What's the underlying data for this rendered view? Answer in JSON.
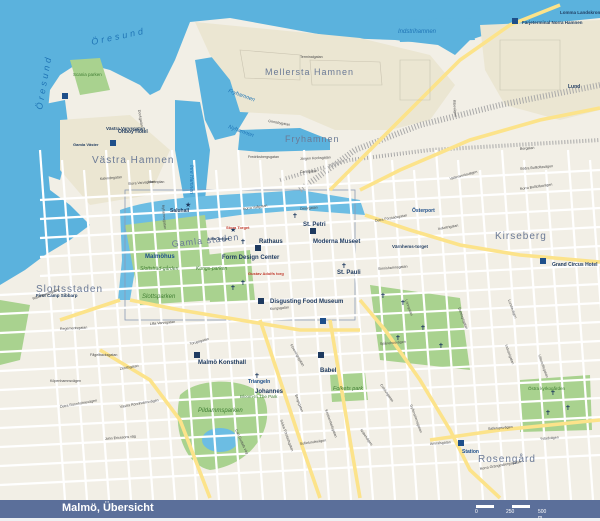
{
  "map": {
    "title": "Malmö, Übersicht",
    "scale": {
      "labels": [
        "0",
        "250",
        "500 m"
      ]
    },
    "water_labels": [
      "Öresund",
      "Öresund",
      "Indstrihamnen",
      "Fryhamnen",
      "Nyhamnen",
      "Inre Hamnen"
    ],
    "districts": [
      "Västra Hamnen",
      "Mellersta Hamnen",
      "Fryhamnen",
      "Gamla staden",
      "Slottsstaden",
      "Kirseberg",
      "Rosengård"
    ],
    "parks": [
      "Scania parken",
      "Slottsträd-gården",
      "Slottsparken",
      "Kungs-parken",
      "Pildammsparken",
      "Folkets park",
      "Östra kyrkogården",
      "Bloom-In The Park"
    ],
    "landmarks": [
      "Malmöhus",
      "St. Petri",
      "Rathaus",
      "Moderna Museet",
      "Form Design Center",
      "Disgusting Food Museum",
      "St. Pauli",
      "Malmö Konsthall",
      "Triangeln",
      "Johannes",
      "Babel",
      "Saluhall",
      "Grand Circus Hotel",
      "Ohboy Hotel",
      "Gamla Väster",
      "Stora Torget",
      "Lilla Torget",
      "Gustav Adolfs torg",
      "Färjeterminal Norra Hamnen",
      "Lomma Landskrona",
      "Lund",
      "Österport",
      "Värnhems-torget",
      "Station",
      "Västra Varvsgatan",
      "First Camp Sibbarp"
    ],
    "streets": [
      "Terminalgatan",
      "Grimsbygatan",
      "Jörgen Kocksgatan",
      "Carlsgatan",
      "Hamnplan",
      "Nyhamnsgatan",
      "Östra Förstadsgatan",
      "Norra Vallgatan",
      "Östergatan",
      "Regementsgatan",
      "Fågelbacksgatan",
      "Köpenhamnsvägen",
      "Kungsgatan",
      "Föreningsgatan",
      "Amiralsgatan",
      "Ystadvägen",
      "Nobelvägen",
      "Spånehusvägen",
      "Industrigatan",
      "Lönngatan",
      "Ribersborgsgatan",
      "Dockgatan",
      "Stora Varvsgatan",
      "Carl Gustafs väg",
      "Södra Förstadsgatan",
      "Bergsgatan",
      "Kristianstadsgatan",
      "Sofielundsvägen",
      "Celsiusgatan",
      "Gyllenstiernsgatan",
      "Torupsgatan",
      "Zenithgatan",
      "Västra Rönnholmsvägen",
      "Östra Rönnholmsvägen",
      "John Ericssons väg",
      "Ribevägen",
      "Borgatan",
      "Södra Bulltoftavägen",
      "Norra Bulltoftavägen",
      "Vattenverksvägen",
      "Lundavägen",
      "Sallerupsvägen",
      "Norra Grängesbergsgatan",
      "Villemollegatan",
      "Dalslagsgatan",
      "Simrishamnsgatan",
      "Industrigatan",
      "Kalendegatan",
      "Fredriksbergsgatan",
      "Lilla Varvsgatan",
      "Bjurbäcksgatan",
      "Slottsgatan"
    ]
  },
  "colors": {
    "water": "#5bb2dd",
    "land": "#f2efe6",
    "industrial": "#ebe6d2",
    "park": "#a9d28f",
    "road_major": "#fce38a",
    "road": "#ffffff",
    "footer": "#5b6f9a",
    "rail": "#a9a9a9",
    "district_text": "#6b7a96",
    "water_text": "#1f74b5"
  }
}
